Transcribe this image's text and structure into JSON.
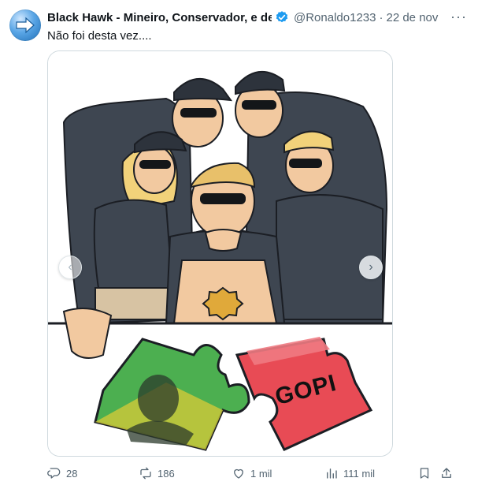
{
  "tweet": {
    "author_name": "Black Hawk - Mineiro, Conservador, e de",
    "handle": "@Ronaldo1233",
    "separator": "·",
    "date": "22 de nov",
    "text": "Não foi desta vez....",
    "more_label": "···"
  },
  "media": {
    "puzzle_text": "GOPI",
    "prev_label": "‹",
    "next_label": "›"
  },
  "actions": {
    "replies": "28",
    "reposts": "186",
    "likes": "1 mil",
    "views": "111 mil"
  },
  "colors": {
    "verified_blue": "#1d9bf0",
    "muted_text": "#536471",
    "puzzle_green": "#4caf50",
    "puzzle_yellow": "#c9c83a",
    "puzzle_red": "#e84b55",
    "uniform_dark": "#3e4651"
  }
}
